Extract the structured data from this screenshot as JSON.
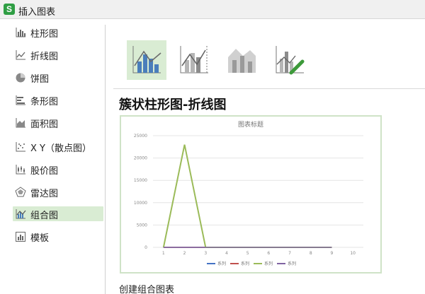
{
  "window": {
    "title": "插入图表",
    "app_icon_letter": "S"
  },
  "sidebar": {
    "items": [
      {
        "label": "柱形图",
        "icon": "column-chart-icon"
      },
      {
        "label": "折线图",
        "icon": "line-chart-icon"
      },
      {
        "label": "饼图",
        "icon": "pie-chart-icon"
      },
      {
        "label": "条形图",
        "icon": "bar-chart-icon"
      },
      {
        "label": "面积图",
        "icon": "area-chart-icon"
      },
      {
        "label": "X Y（散点图）",
        "icon": "scatter-chart-icon"
      },
      {
        "label": "股价图",
        "icon": "stock-chart-icon"
      },
      {
        "label": "雷达图",
        "icon": "radar-chart-icon"
      },
      {
        "label": "组合图",
        "icon": "combo-chart-icon",
        "selected": true
      },
      {
        "label": "模板",
        "icon": "template-icon"
      }
    ]
  },
  "subtypes": [
    {
      "icon": "clustered-column-line-icon",
      "selected": true
    },
    {
      "icon": "clustered-column-line-secondary-axis-icon"
    },
    {
      "icon": "stacked-area-clustered-column-icon"
    },
    {
      "icon": "custom-combination-icon"
    }
  ],
  "main": {
    "heading": "簇状柱形图-折线图",
    "footer_label": "创建组合图表"
  },
  "colors": {
    "selected_bg": "#d9ecd3",
    "accent_green": "#2f9e44"
  },
  "chart_data": {
    "type": "line",
    "title": "图表标题",
    "x": [
      1,
      2,
      3,
      4,
      5,
      6,
      7,
      8,
      9,
      10
    ],
    "ylim": [
      0,
      25000
    ],
    "yticks": [
      0,
      5000,
      10000,
      15000,
      20000,
      25000
    ],
    "ytick_labels": [
      "0",
      "5000",
      "10000",
      "15000",
      "20000",
      "25000"
    ],
    "grid": true,
    "legend": "bottom",
    "series": [
      {
        "name": "系列",
        "color": "#4472c4",
        "values": [
          0,
          0,
          0,
          0,
          0,
          0,
          0,
          0,
          0,
          null
        ]
      },
      {
        "name": "系列",
        "color": "#c0504d",
        "values": [
          0,
          0,
          0,
          0,
          0,
          0,
          0,
          0,
          0,
          null
        ]
      },
      {
        "name": "系列",
        "color": "#9bbb59",
        "values": [
          0,
          23000,
          0,
          0,
          0,
          0,
          0,
          0,
          0,
          null
        ]
      },
      {
        "name": "系列",
        "color": "#8064a2",
        "values": [
          0,
          0,
          0,
          0,
          0,
          0,
          0,
          0,
          0,
          null
        ]
      }
    ]
  }
}
